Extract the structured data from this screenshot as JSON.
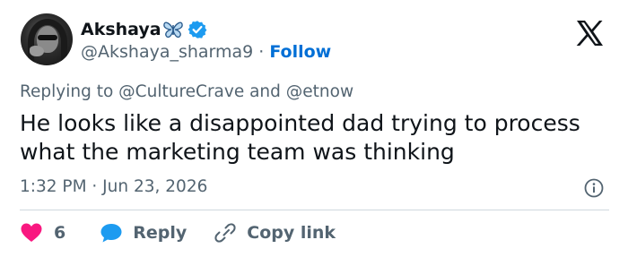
{
  "author": {
    "name": "Akshaya",
    "emoji": "🦋",
    "handle": "@Akshaya_sharma9",
    "separator": "·",
    "follow_label": "Follow"
  },
  "reply_context": "Replying to @CultureCrave and @etnow",
  "tweet": {
    "text": "He looks like a disappointed dad trying to process what the marketing team was thinking",
    "timestamp": "1:32 PM · Jun 23, 2026"
  },
  "actions": {
    "like_count": "6",
    "reply_label": "Reply",
    "copy_label": "Copy link"
  },
  "colors": {
    "like": "#f91880",
    "reply": "#1d9bf0",
    "verified": "#1d9bf0",
    "follow": "#006fd6",
    "secondary_text": "#536471",
    "divider": "#cfd9de"
  },
  "icons": [
    "avatar",
    "butterfly-emoji",
    "verified-badge-icon",
    "x-logo-icon",
    "info-icon",
    "heart-icon",
    "reply-bubble-icon",
    "link-icon"
  ]
}
